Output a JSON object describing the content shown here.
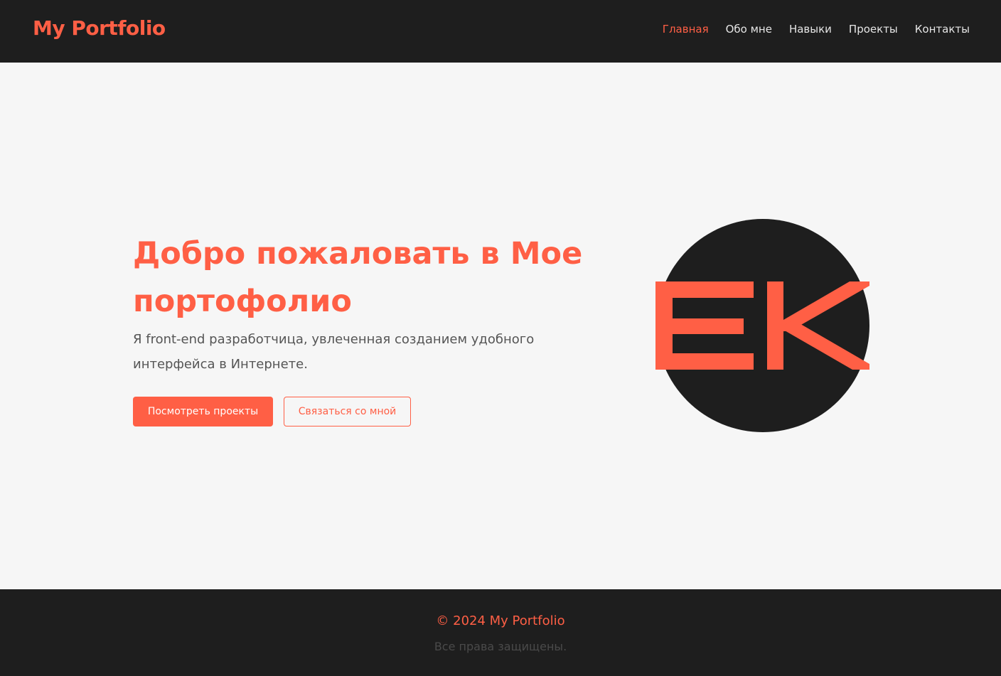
{
  "header": {
    "logo": "My Portfolio",
    "nav": [
      {
        "label": "Главная",
        "active": true
      },
      {
        "label": "Обо мне",
        "active": false
      },
      {
        "label": "Навыки",
        "active": false
      },
      {
        "label": "Проекты",
        "active": false
      },
      {
        "label": "Контакты",
        "active": false
      }
    ]
  },
  "hero": {
    "title": "Добро пожаловать в Мое портофолио",
    "text": "Я front-end разработчица, увлеченная созданием удобного интерфейса в Интернете.",
    "primary_button": "Посмотреть проекты",
    "secondary_button": "Связаться со мной",
    "avatar_initials": "EK"
  },
  "footer": {
    "copyright": "© 2024 My Portfolio",
    "rights": "Все права защищены."
  },
  "colors": {
    "accent": "#ff5f45",
    "dark": "#1e1e1e",
    "background": "#f6f6f6"
  }
}
